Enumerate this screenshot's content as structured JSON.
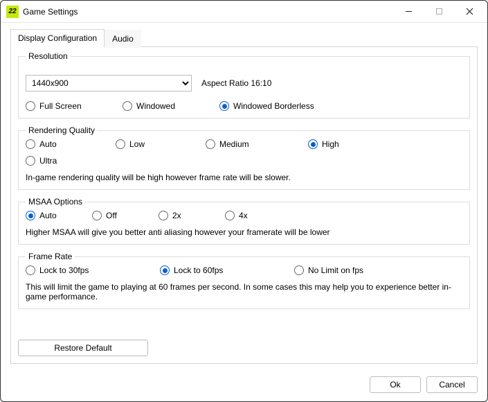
{
  "window": {
    "icon_text": "22",
    "title": "Game Settings"
  },
  "tabs": {
    "display": "Display Configuration",
    "audio": "Audio"
  },
  "resolution": {
    "legend": "Resolution",
    "selected": "1440x900",
    "aspect_label": "Aspect Ratio 16:10",
    "window_modes": {
      "fullscreen": "Full Screen",
      "windowed": "Windowed",
      "windowed_borderless": "Windowed Borderless"
    }
  },
  "rendering": {
    "legend": "Rendering Quality",
    "options": {
      "auto": "Auto",
      "low": "Low",
      "medium": "Medium",
      "high": "High",
      "ultra": "Ultra"
    },
    "description": "In-game rendering quality will be high however frame rate will be slower."
  },
  "msaa": {
    "legend": "MSAA Options",
    "options": {
      "auto": "Auto",
      "off": "Off",
      "x2": "2x",
      "x4": "4x"
    },
    "description": "Higher MSAA will give you better anti aliasing however your framerate will be lower"
  },
  "framerate": {
    "legend": "Frame Rate",
    "options": {
      "lock30": "Lock  to 30fps",
      "lock60": "Lock to 60fps",
      "nolimit": "No Limit on fps"
    },
    "description": "This will limit the game to playing at 60 frames per second. In some cases this may help you to experience better in-game performance."
  },
  "buttons": {
    "restore": "Restore Default",
    "ok": "Ok",
    "cancel": "Cancel"
  }
}
